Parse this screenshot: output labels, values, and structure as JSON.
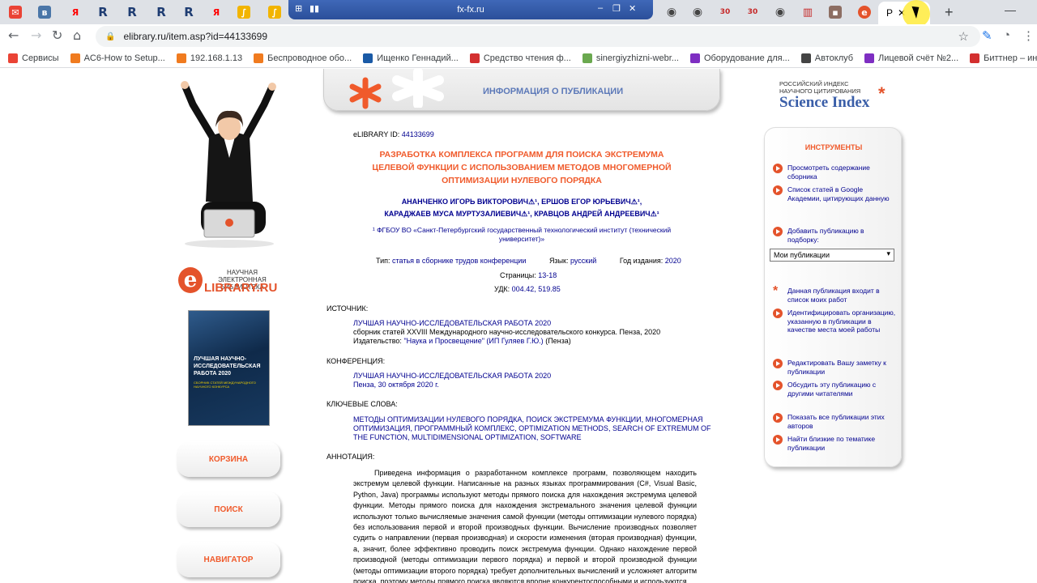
{
  "browser": {
    "tabs_favicons": [
      {
        "icon": "gmail-icon",
        "color": "#ea4335",
        "glyph": "M"
      },
      {
        "icon": "vk-icon",
        "color": "#4a76a8",
        "glyph": "В"
      },
      {
        "icon": "yandex-icon",
        "color": "#ff0000",
        "glyph": "Я"
      },
      {
        "icon": "rutube-icon",
        "color": "#1e3c72",
        "glyph": "R"
      },
      {
        "icon": "rutube-icon",
        "color": "#1e3c72",
        "glyph": "R"
      },
      {
        "icon": "rutube-icon",
        "color": "#1e3c72",
        "glyph": "R"
      },
      {
        "icon": "rutube-icon",
        "color": "#1e3c72",
        "glyph": "R"
      },
      {
        "icon": "yandex-icon",
        "color": "#ff0000",
        "glyph": "Я"
      },
      {
        "icon": "folder-icon",
        "color": "#f2b400",
        "glyph": "∫"
      }
    ],
    "overlay_title": "fx-fx.ru",
    "active_tab_label": "Р",
    "url": "elibrary.ru/item.asp?id=44133699",
    "bookmarks": [
      {
        "label": "Сервисы",
        "color": "#ea4335"
      },
      {
        "label": "AC6-How to Setup...",
        "color": "#f07b1f"
      },
      {
        "label": "192.168.1.13",
        "color": "#f07b1f"
      },
      {
        "label": "Беспроводное обо...",
        "color": "#f07b1f"
      },
      {
        "label": "Ищенко Геннадий...",
        "color": "#1a5aa6"
      },
      {
        "label": "Средство чтения ф...",
        "color": "#d32f2f"
      },
      {
        "label": "sinergiyzhizni-webr...",
        "color": "#6aa84f"
      },
      {
        "label": "Оборудование для...",
        "color": "#7e2ec2"
      },
      {
        "label": "Автоклуб",
        "color": "#444444"
      },
      {
        "label": "Лицевой счёт №2...",
        "color": "#7e2ec2"
      },
      {
        "label": "Биттнер – инструк...",
        "color": "#d32f2f"
      }
    ]
  },
  "left": {
    "elib_caption": "НАУЧНАЯ ЭЛЕКТРОННАЯ БИБЛИОТЕКА",
    "elib_name": "LIBRARY.RU",
    "cover_title": "ЛУЧШАЯ НАУЧНО-ИССЛЕДОВАТЕЛЬСКАЯ РАБОТА 2020",
    "cover_subtitle": "СБОРНИК СТАТЕЙ МЕЖДУНАРОДНОГО НАУЧНОГО КОНКУРСА",
    "buttons": [
      "КОРЗИНА",
      "ПОИСК",
      "НАВИГАТОР"
    ]
  },
  "header": {
    "title": "ИНФОРМАЦИЯ О ПУБЛИКАЦИИ"
  },
  "pub": {
    "id_label": "eLIBRARY ID:",
    "id": "44133699",
    "title_lines": [
      "РАЗРАБОТКА КОМПЛЕКСА ПРОГРАММ ДЛЯ ПОИСКА ЭКСТРЕМУМА",
      "ЦЕЛЕВОЙ ФУНКЦИИ С ИСПОЛЬЗОВАНИЕМ МЕТОДОВ МНОГОМЕРНОЙ",
      "ОПТИМИЗАЦИИ НУЛЕВОГО ПОРЯДКА"
    ],
    "authors_line1": "АНАНЧЕНКО ИГОРЬ ВИКТОРОВИЧ⚠¹, ЕРШОВ ЕГОР ЮРЬЕВИЧ⚠¹,",
    "authors_line2": "КАРАДЖАЕВ МУСА МУРТУЗАЛИЕВИЧ⚠¹, КРАВЦОВ АНДРЕЙ АНДРЕЕВИЧ⚠¹",
    "affiliation_line1": "¹ ФГБОУ ВО «Санкт-Петербургский государственный технологический институт (технический",
    "affiliation_line2": "университет)»",
    "type_label": "Тип:",
    "type": "статья в сборнике трудов конференции",
    "lang_label": "Язык:",
    "lang": "русский",
    "year_label": "Год издания:",
    "year": "2020",
    "pages_label": "Страницы:",
    "pages": "13-18",
    "udc_label": "УДК:",
    "udc": "004.42, 519.85",
    "source_label": "ИСТОЧНИК:",
    "source_title": "ЛУЧШАЯ НАУЧНО-ИССЛЕДОВАТЕЛЬСКАЯ РАБОТА 2020",
    "source_desc": "сборник статей XXVIII Международного научно-исследовательского конкурса. Пенза, 2020",
    "publisher_label": "Издательство:",
    "publisher": "\"Наука и Просвещение\" (ИП Гуляев Г.Ю.)",
    "publisher_city": "(Пенза)",
    "conf_label": "КОНФЕРЕНЦИЯ:",
    "conf_title": "ЛУЧШАЯ НАУЧНО-ИССЛЕДОВАТЕЛЬСКАЯ РАБОТА 2020",
    "conf_place": "Пенза, 30 октября 2020 г.",
    "kw_label": "КЛЮЧЕВЫЕ СЛОВА:",
    "kw_line1": "МЕТОДЫ ОПТИМИЗАЦИИ НУЛЕВОГО ПОРЯДКА, ПОИСК ЭКСТРЕМУМА ФУНКЦИИ, МНОГОМЕРНАЯ",
    "kw_line2": "ОПТИМИЗАЦИЯ, ПРОГРАММНЫЙ КОМПЛЕКС, OPTIMIZATION METHODS, SEARCH OF EXTREMUM OF",
    "kw_line3": "THE FUNCTION, MULTIDIMENSIONAL OPTIMIZATION, SOFTWARE",
    "abstract_label": "АННОТАЦИЯ:",
    "abstract": "Приведена информация о разработанном комплексе программ, позволяющем находить экстремум целевой функции. Написанные на разных языках программирования (C#, Visual Basic, Python, Java) программы используют методы прямого поиска для нахождения экстремума целевой функции. Методы прямого поиска для нахождения экстремального значения целевой функции используют только вычисляемые значения самой функции (методы оптимизации нулевого порядка) без использования первой и второй производных функции. Вычисление производных позволяет судить о направлении (первая производная) и скорости изменения (вторая производная) функции, а, значит, более эффективно проводить поиск экстремума функции. Однако нахождение первой производной (методы оптимизации первого порядка) и первой и второй производной функции (методы оптимизации второго порядка) требует дополнительных вычислений и усложняет алгоритм поиска, поэтому методы прямого поиска являются вполне конкурентоспособными и используются"
  },
  "right": {
    "logo_small": "РОССИЙСКИЙ ИНДЕКС НАУЧНОГО ЦИТИРОВАНИЯ",
    "logo_big": "Science Index",
    "tools_title": "ИНСТРУМЕНТЫ",
    "items": [
      "Просмотреть содержание сборника",
      "Список статей в Google Академии, цитирующих данную",
      "Добавить публикацию в подборку:",
      "Данная публикация входит в список моих работ",
      "Идентифицировать организацию, указанную в публикации в качестве места моей работы",
      "Редактировать Вашу заметку к публикации",
      "Обсудить эту публикацию с другими читателями",
      "Показать все публикации этих авторов",
      "Найти близкие по тематике публикации"
    ],
    "select_value": "Мои публикации"
  }
}
